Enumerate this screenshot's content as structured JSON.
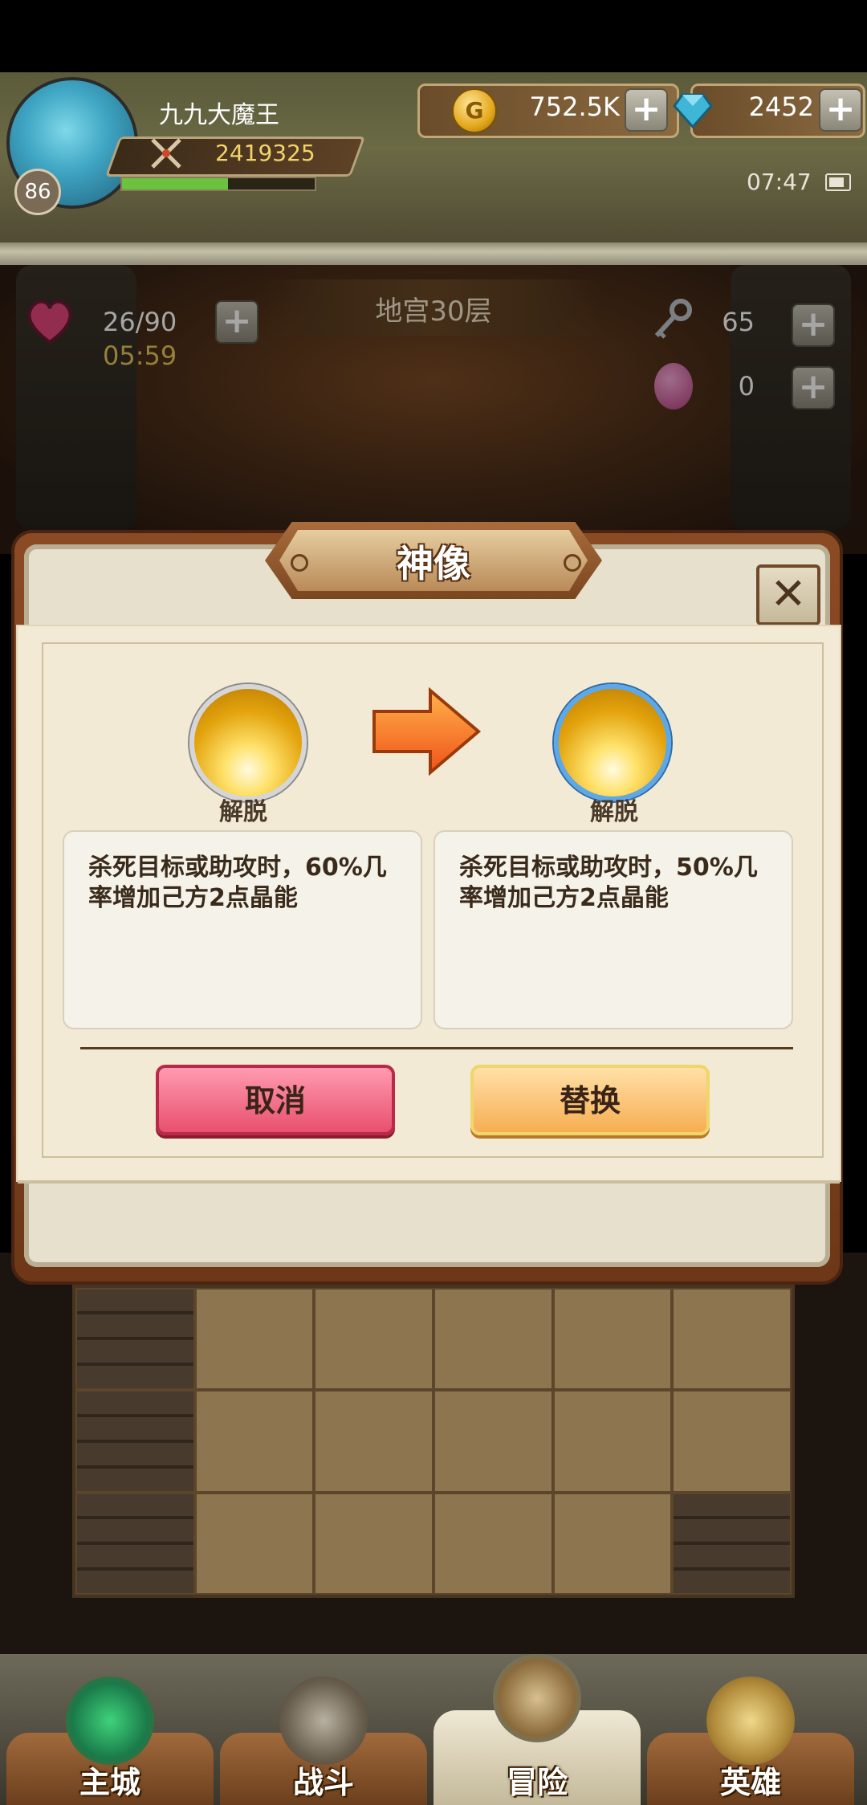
{
  "player": {
    "name": "九九大魔王",
    "level": "86",
    "power": "2419325",
    "exp_fraction": 0.55
  },
  "resources": {
    "gold": "752.5K",
    "gems": "2452"
  },
  "system": {
    "time": "07:47"
  },
  "dungeon": {
    "floor_title": "地宫30层",
    "stamina": "26/90",
    "stamina_timer": "05:59",
    "keys": "65",
    "eggs": "0"
  },
  "modal": {
    "title": "神像",
    "close_symbol": "✕",
    "current_skill": {
      "name": "解脱",
      "description": "杀死目标或助攻时，60%几率增加己方2点晶能"
    },
    "new_skill": {
      "name": "解脱",
      "description": "杀死目标或助攻时，50%几率增加己方2点晶能"
    },
    "cancel_label": "取消",
    "replace_label": "替换"
  },
  "nav": {
    "tabs": [
      {
        "label": "主城",
        "icon": "castle-icon",
        "active": false
      },
      {
        "label": "战斗",
        "icon": "crossed-swords-icon",
        "active": false
      },
      {
        "label": "冒险",
        "icon": "scroll-map-icon",
        "active": true
      },
      {
        "label": "英雄",
        "icon": "hero-emblem-icon",
        "active": false
      }
    ]
  },
  "colors": {
    "cancel": "#e8506e",
    "replace": "#f6ae52",
    "modal_frame": "#8a4a24",
    "paper": "#f3ead5"
  }
}
